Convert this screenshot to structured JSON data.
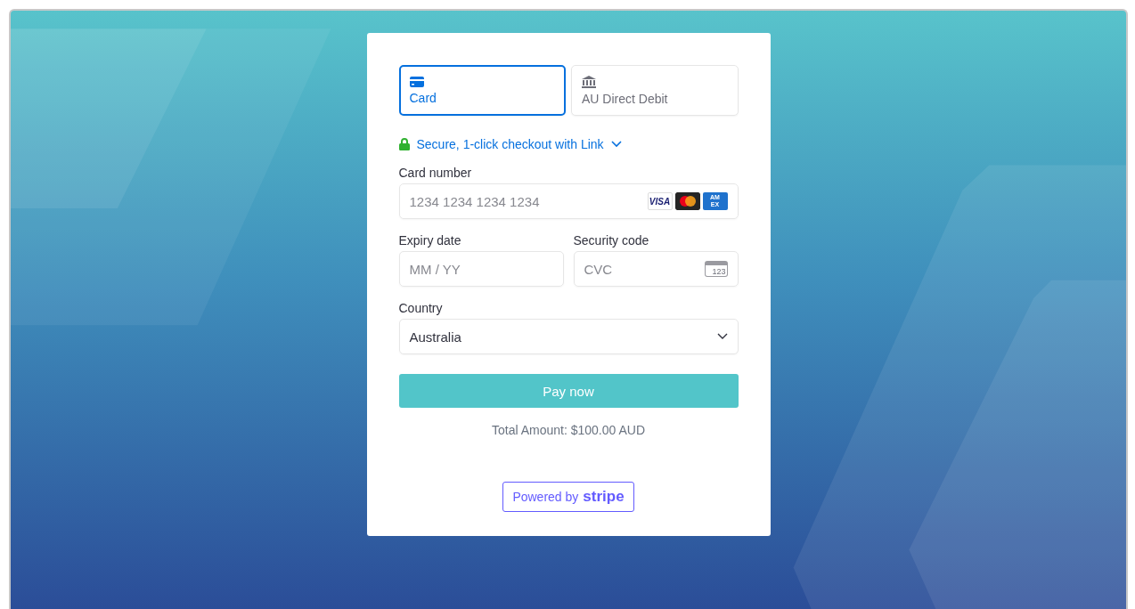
{
  "tabs": [
    {
      "label": "Card",
      "kind": "card",
      "selected": true
    },
    {
      "label": "AU Direct Debit",
      "kind": "bank",
      "selected": false
    }
  ],
  "link_offer": {
    "label": "Secure, 1-click checkout with Link"
  },
  "card_number": {
    "label": "Card number",
    "placeholder": "1234 1234 1234 1234",
    "brands": [
      {
        "kind": "visa",
        "label": "VISA"
      },
      {
        "kind": "mastercard"
      },
      {
        "kind": "amex",
        "label": "AM EX"
      }
    ]
  },
  "expiry": {
    "label": "Expiry date",
    "placeholder": "MM / YY"
  },
  "security_code": {
    "label": "Security code",
    "placeholder": "CVC",
    "icon_text": "123"
  },
  "country": {
    "label": "Country",
    "value": "Australia"
  },
  "pay_button": "Pay now",
  "total": "Total Amount: $100.00 AUD",
  "badge": {
    "prefix": "Powered by",
    "brand": "stripe"
  }
}
